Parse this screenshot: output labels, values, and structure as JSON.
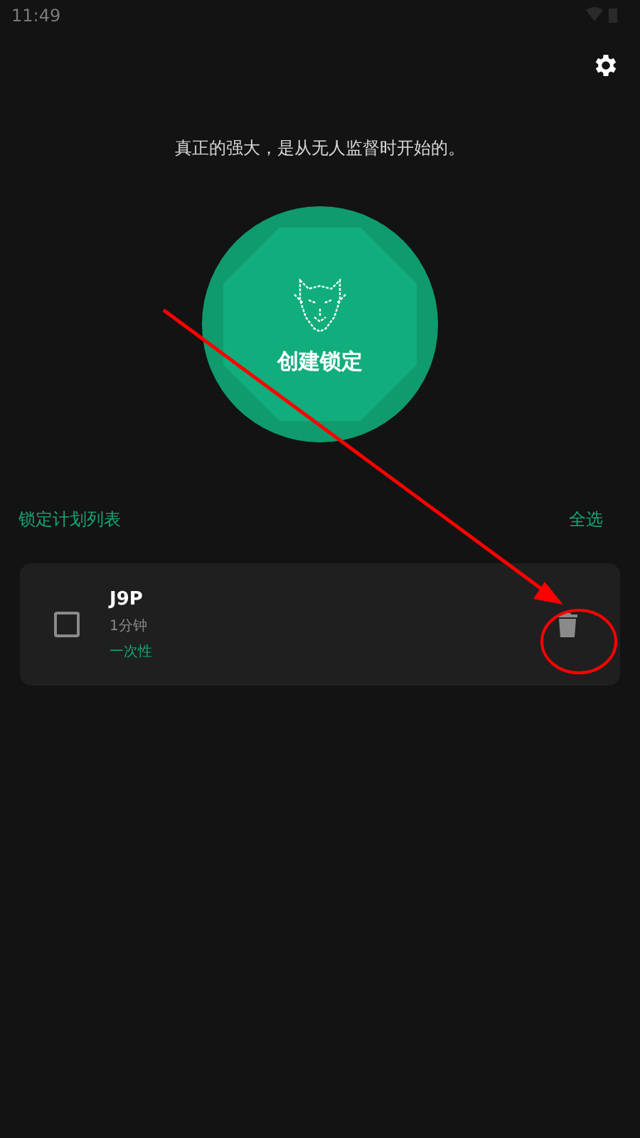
{
  "status_bar": {
    "time": "11:49"
  },
  "motto": "真正的强大，是从无人监督时开始的。",
  "create_button": {
    "label": "创建锁定"
  },
  "list_header": {
    "title": "锁定计划列表",
    "select_all": "全选"
  },
  "plans": [
    {
      "name": "J9P",
      "duration": "1分钟",
      "type": "一次性",
      "checked": false
    }
  ]
}
